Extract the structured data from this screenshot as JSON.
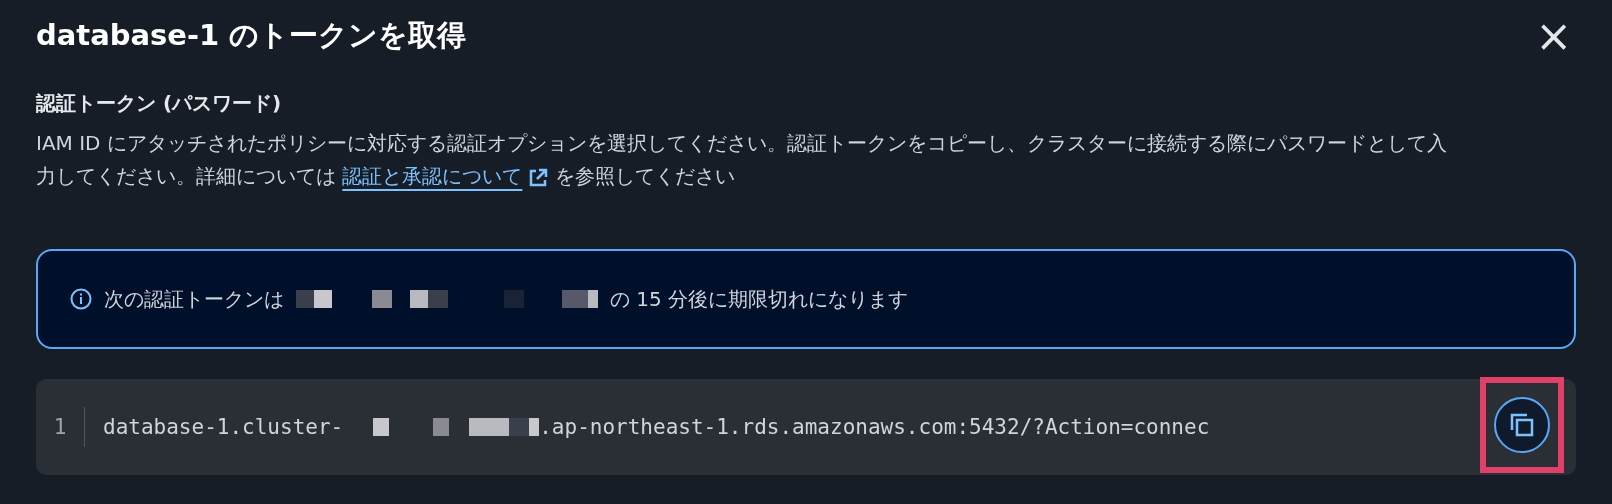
{
  "modal": {
    "title": "database-1 のトークンを取得",
    "close_label": "×"
  },
  "section": {
    "heading": "認証トークン (パスワード)",
    "description_before": "IAM ID にアタッチされたポリシーに対応する認証オプションを選択してください。認証トークンをコピーし、クラスターに接続する際にパスワードとして入力してください。詳細については ",
    "link": "認証と承認について",
    "description_after": " を参照してください"
  },
  "info": {
    "before": "次の認証トークンは",
    "after": "の 15 分後に期限切れになります"
  },
  "code": {
    "line_number": "1",
    "before": "database-1.cluster-",
    "after": ".ap-northeast-1.rds.amazonaws.com:5432/?Action=connec",
    "copy_highlighted": true
  }
}
